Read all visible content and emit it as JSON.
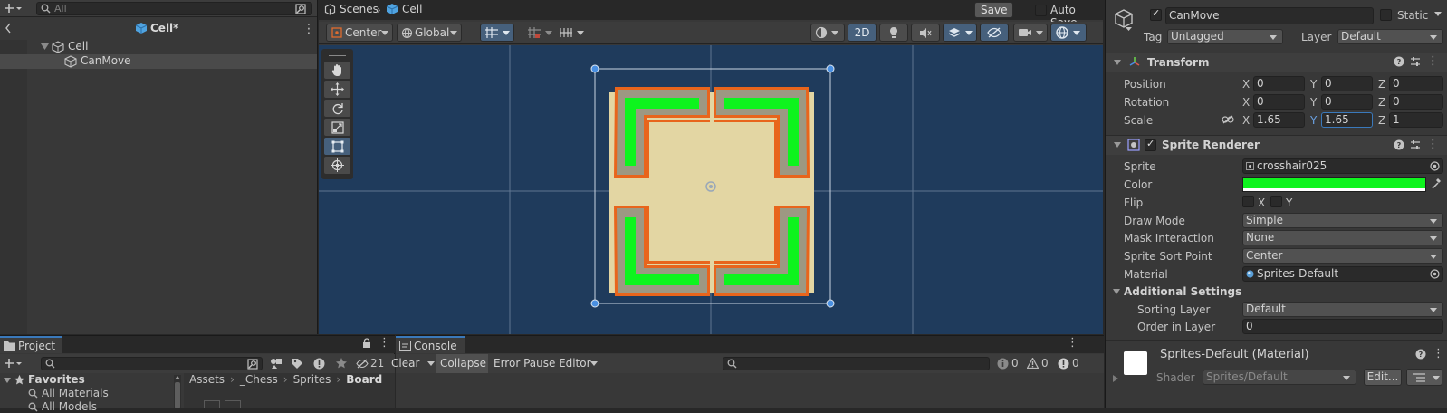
{
  "hierarchy": {
    "search_placeholder": "All",
    "scene_name": "Cell*",
    "items": [
      {
        "label": "Cell"
      },
      {
        "label": "CanMove"
      }
    ]
  },
  "scene": {
    "tabs": {
      "scenes": "Scenes",
      "current": "Cell"
    },
    "save_label": "Save",
    "auto_save_label": "Auto Save",
    "pivot_mode": "Center",
    "pivot_rotation": "Global",
    "mode_2d": "2D",
    "sprite_colors": {
      "border": "#e8651c",
      "green": "#0ef41e",
      "beige": "#e3d6a3",
      "gray": "#9d9882"
    }
  },
  "inspector": {
    "object_name": "CanMove",
    "static_label": "Static",
    "tag_label": "Tag",
    "tag_value": "Untagged",
    "layer_label": "Layer",
    "layer_value": "Default",
    "transform": {
      "title": "Transform",
      "position_label": "Position",
      "rotation_label": "Rotation",
      "scale_label": "Scale",
      "position": {
        "x": "0",
        "y": "0",
        "z": "0"
      },
      "rotation": {
        "x": "0",
        "y": "0",
        "z": "0"
      },
      "scale": {
        "x": "1.65",
        "y": "1.65",
        "z": "1"
      }
    },
    "sprite_renderer": {
      "title": "Sprite Renderer",
      "sprite_label": "Sprite",
      "sprite_value": "crosshair025",
      "color_label": "Color",
      "color_value": "#0ef41e",
      "flip_label": "Flip",
      "flip_x": "X",
      "flip_y": "Y",
      "draw_mode_label": "Draw Mode",
      "draw_mode_value": "Simple",
      "mask_label": "Mask Interaction",
      "mask_value": "None",
      "sort_point_label": "Sprite Sort Point",
      "sort_point_value": "Center",
      "material_label": "Material",
      "material_value": "Sprites-Default",
      "additional_title": "Additional Settings",
      "sorting_layer_label": "Sorting Layer",
      "sorting_layer_value": "Default",
      "order_label": "Order in Layer",
      "order_value": "0"
    },
    "material": {
      "title": "Sprites-Default (Material)",
      "shader_label": "Shader",
      "shader_value": "Sprites/Default",
      "edit_label": "Edit..."
    }
  },
  "project": {
    "tab_label": "Project",
    "hidden_count": "21",
    "favorites_label": "Favorites",
    "favorites": [
      "All Materials",
      "All Models"
    ],
    "breadcrumb": [
      "Assets",
      "_Chess",
      "Sprites",
      "Board"
    ]
  },
  "console": {
    "tab_label": "Console",
    "clear_label": "Clear",
    "collapse_label": "Collapse",
    "error_pause_label": "Error Pause",
    "editor_label": "Editor",
    "info_count": "0",
    "warning_count": "0",
    "error_count": "0"
  }
}
